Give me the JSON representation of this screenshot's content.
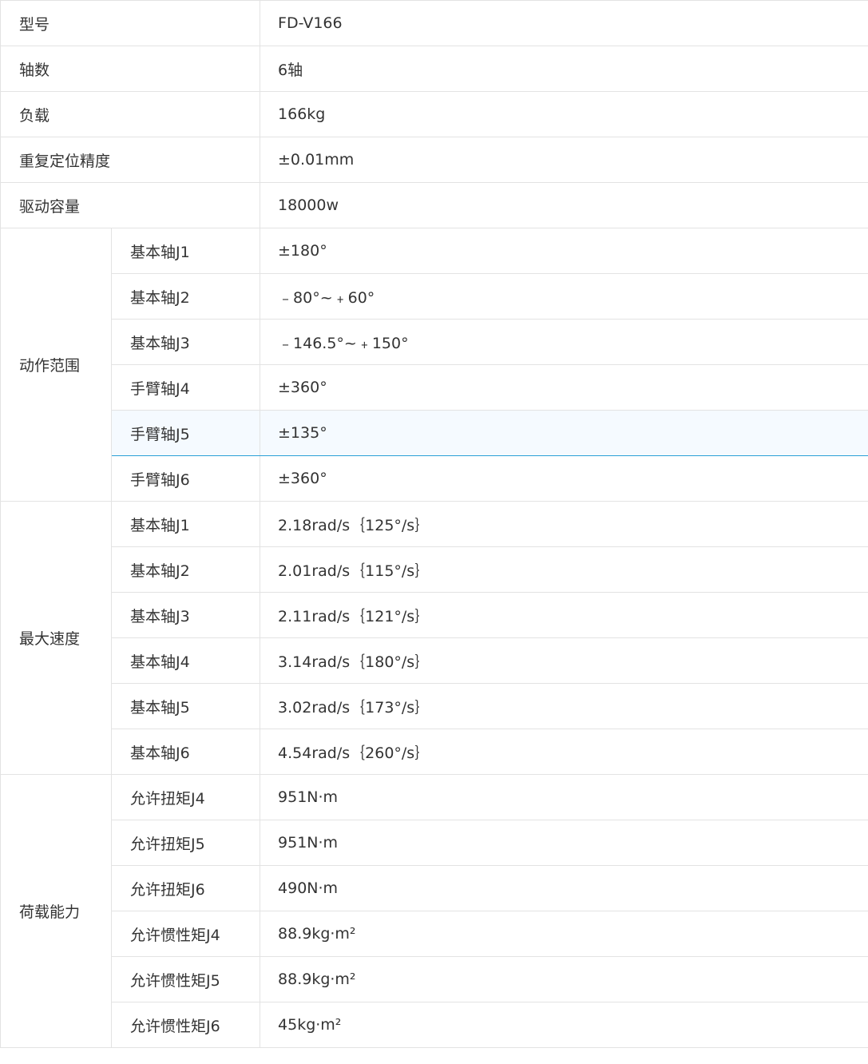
{
  "basic": [
    {
      "label": "型号",
      "value": "FD-V166"
    },
    {
      "label": "轴数",
      "value": "6轴"
    },
    {
      "label": "负载",
      "value": "166kg"
    },
    {
      "label": "重复定位精度",
      "value": "±0.01mm"
    },
    {
      "label": "驱动容量",
      "value": "18000w"
    }
  ],
  "groups": [
    {
      "label": "动作范围",
      "rows": [
        {
          "label": "基本轴J1",
          "value": "±180°"
        },
        {
          "label": "基本轴J2",
          "value": "﹣80°~﹢60°"
        },
        {
          "label": "基本轴J3",
          "value": "﹣146.5°~﹢150°"
        },
        {
          "label": "手臂轴J4",
          "value": "±360°"
        },
        {
          "label": "手臂轴J5",
          "value": "±135°"
        },
        {
          "label": "手臂轴J6",
          "value": "±360°"
        }
      ]
    },
    {
      "label": "最大速度",
      "rows": [
        {
          "label": "基本轴J1",
          "value": "2.18rad/s｛125°/s｝"
        },
        {
          "label": "基本轴J2",
          "value": "2.01rad/s｛115°/s｝"
        },
        {
          "label": "基本轴J3",
          "value": "2.11rad/s｛121°/s｝"
        },
        {
          "label": "基本轴J4",
          "value": "3.14rad/s｛180°/s｝"
        },
        {
          "label": "基本轴J5",
          "value": "3.02rad/s｛173°/s｝"
        },
        {
          "label": "基本轴J6",
          "value": "4.54rad/s｛260°/s｝"
        }
      ]
    },
    {
      "label": "荷载能力",
      "rows": [
        {
          "label": "允许扭矩J4",
          "value": "951N·m"
        },
        {
          "label": "允许扭矩J5",
          "value": "951N·m"
        },
        {
          "label": "允许扭矩J6",
          "value": "490N·m"
        },
        {
          "label": "允许惯性矩J4",
          "value": "88.9kg·m²"
        },
        {
          "label": "允许惯性矩J5",
          "value": "88.9kg·m²"
        },
        {
          "label": "允许惯性矩J6",
          "value": "45kg·m²"
        }
      ]
    }
  ]
}
